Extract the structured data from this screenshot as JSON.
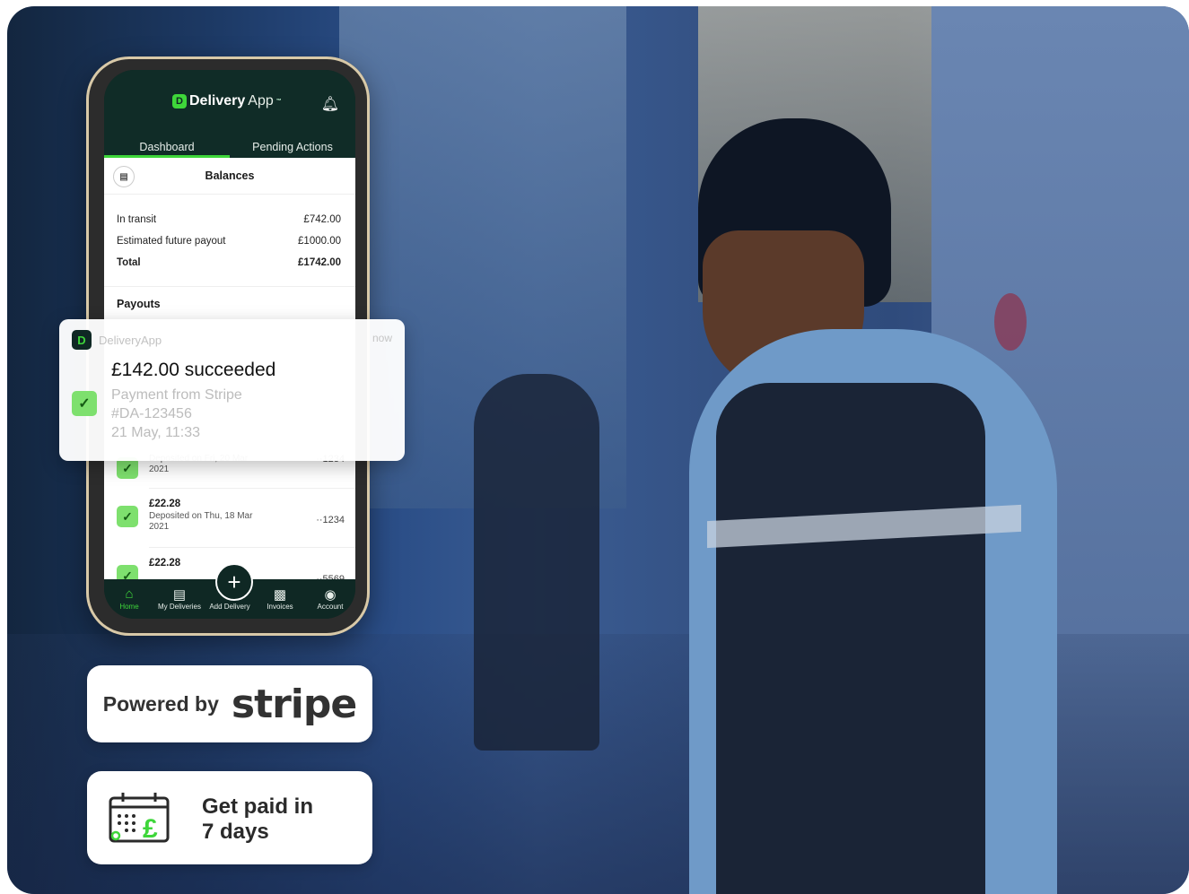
{
  "app": {
    "name_bold": "Delivery",
    "name_light": "App",
    "trademark": "™"
  },
  "tabs": [
    {
      "label": "Dashboard"
    },
    {
      "label": "Pending Actions"
    }
  ],
  "balances": {
    "title": "Balances",
    "rows": [
      {
        "label": "In transit",
        "value": "£742.00"
      },
      {
        "label": "Estimated future payout",
        "value": "£1000.00"
      },
      {
        "label": "Total",
        "value": "£1742.00"
      }
    ]
  },
  "payouts": {
    "title": "Payouts",
    "items": [
      {
        "sub": "Deposited on Fri, 20 Mar 2021",
        "account": "··1234"
      },
      {
        "amount": "£22.28",
        "sub": "Deposited on Thu, 18 Mar 2021",
        "account": "··1234"
      },
      {
        "amount": "£22.28",
        "sub": "",
        "account": "··5569"
      }
    ]
  },
  "nav": [
    {
      "label": "Home",
      "icon": "home-icon"
    },
    {
      "label": "My Deliveries",
      "icon": "truck-icon"
    },
    {
      "label": "Add Delivery",
      "icon": "plus-icon"
    },
    {
      "label": "Invoices",
      "icon": "document-icon"
    },
    {
      "label": "Account",
      "icon": "user-icon"
    }
  ],
  "notification": {
    "app": "DeliveryApp",
    "time": "now",
    "title": "£142.00 succeeded",
    "line1": "Payment from Stripe",
    "line2": "#DA-123456",
    "line3": "21 May, 11:33"
  },
  "stripe_badge": {
    "prefix": "Powered by",
    "brand": "stripe"
  },
  "pay_card": {
    "line1": "Get paid in",
    "line2": "7 days"
  },
  "colors": {
    "brand_green": "#3ed63a",
    "app_dark": "#0f2824"
  }
}
